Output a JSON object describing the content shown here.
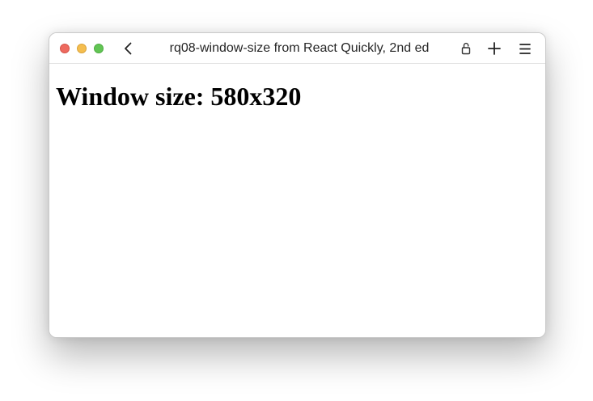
{
  "window": {
    "title": "rq08-window-size from React Quickly, 2nd ed",
    "controls": {
      "close_color": "#ee6a5f",
      "minimize_color": "#f5be4f",
      "maximize_color": "#62c554"
    },
    "toolbar_icons": [
      "chevron-left-icon",
      "lock-open-icon",
      "plus-icon",
      "hamburger-menu-icon"
    ]
  },
  "content": {
    "heading": "Window size: 580x320"
  }
}
